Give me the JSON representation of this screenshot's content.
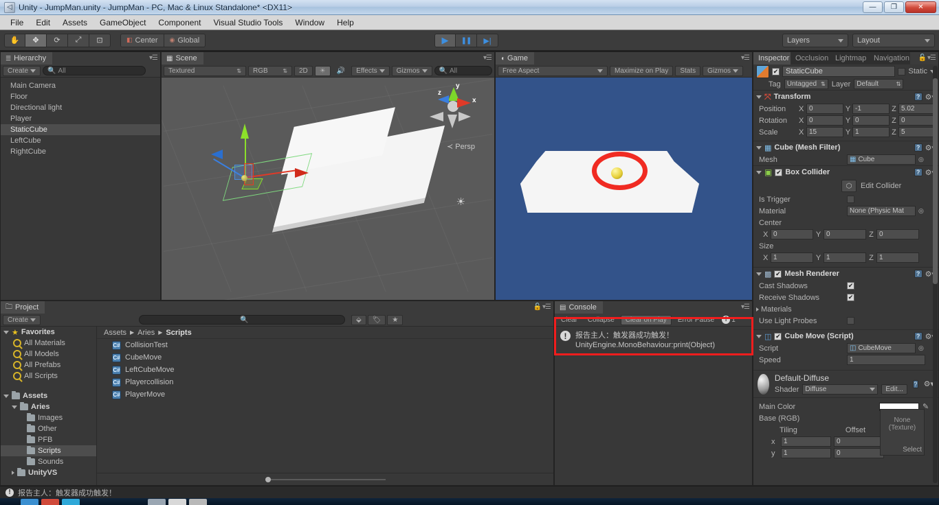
{
  "window": {
    "title": "Unity - JumpMan.unity - JumpMan - PC, Mac & Linux Standalone* <DX11>",
    "minimize": "—",
    "maximize": "❐",
    "close": "✕"
  },
  "menubar": {
    "items": [
      "File",
      "Edit",
      "Assets",
      "GameObject",
      "Component",
      "Visual Studio Tools",
      "Window",
      "Help"
    ]
  },
  "toolbar": {
    "tools": [
      {
        "name": "hand-tool",
        "glyph": "✋",
        "active": false
      },
      {
        "name": "move-tool",
        "glyph": "✥",
        "active": true
      },
      {
        "name": "rotate-tool",
        "glyph": "⟳",
        "active": false
      },
      {
        "name": "scale-tool",
        "glyph": "⤢",
        "active": false
      },
      {
        "name": "rect-tool",
        "glyph": "⊡",
        "active": false
      }
    ],
    "pivot_label": "Center",
    "space_label": "Global",
    "play": "▶",
    "pause": "❚❚",
    "step": "▶|",
    "layers_label": "Layers",
    "layout_label": "Layout"
  },
  "hierarchy": {
    "tab": "Hierarchy",
    "create_label": "Create",
    "search_placeholder": "All",
    "items": [
      {
        "label": "Main Camera",
        "selected": false
      },
      {
        "label": "Floor",
        "selected": false
      },
      {
        "label": "Directional light",
        "selected": false
      },
      {
        "label": "Player",
        "selected": false
      },
      {
        "label": "StaticCube",
        "selected": true
      },
      {
        "label": "LeftCube",
        "selected": false
      },
      {
        "label": "RightCube",
        "selected": false
      }
    ]
  },
  "scene": {
    "tab": "Scene",
    "draw_mode": "Textured",
    "color_mode": "RGB",
    "mode_2d": "2D",
    "effects": "Effects",
    "gizmos": "Gizmos",
    "search_placeholder": "All",
    "persp_label": "Persp",
    "gizmo_axes": {
      "x": "x",
      "y": "y",
      "z": "z"
    }
  },
  "game": {
    "tab": "Game",
    "aspect": "Free Aspect",
    "maximize_on_play": "Maximize on Play",
    "stats": "Stats",
    "gizmos": "Gizmos",
    "background_color": "#33538a",
    "annotation_color": "#f02b22"
  },
  "inspector": {
    "tabs": [
      "Inspector",
      "Occlusion",
      "Lightmap",
      "Navigation"
    ],
    "object_name": "StaticCube",
    "static_label": "Static",
    "static_checked": false,
    "enabled_checked": true,
    "tag_label": "Tag",
    "tag_value": "Untagged",
    "layer_label": "Layer",
    "layer_value": "Default",
    "transform": {
      "title": "Transform",
      "rows": [
        {
          "label": "Position",
          "x": "0",
          "y": "-1",
          "z": "5.02"
        },
        {
          "label": "Rotation",
          "x": "0",
          "y": "0",
          "z": "0"
        },
        {
          "label": "Scale",
          "x": "15",
          "y": "1",
          "z": "5"
        }
      ]
    },
    "mesh_filter": {
      "title": "Cube (Mesh Filter)",
      "mesh_label": "Mesh",
      "mesh_value": "Cube"
    },
    "box_collider": {
      "title": "Box Collider",
      "enabled": true,
      "edit_collider": "Edit Collider",
      "is_trigger_label": "Is Trigger",
      "is_trigger_checked": false,
      "material_label": "Material",
      "material_value": "None (Physic Mat",
      "center_label": "Center",
      "center": {
        "x": "0",
        "y": "0",
        "z": "0"
      },
      "size_label": "Size",
      "size": {
        "x": "1",
        "y": "1",
        "z": "1"
      }
    },
    "mesh_renderer": {
      "title": "Mesh Renderer",
      "enabled": true,
      "cast_shadows_label": "Cast Shadows",
      "cast_shadows_checked": true,
      "receive_shadows_label": "Receive Shadows",
      "receive_shadows_checked": true,
      "materials_label": "Materials",
      "use_light_probes_label": "Use Light Probes",
      "use_light_probes_checked": false
    },
    "cube_move": {
      "title": "Cube Move (Script)",
      "enabled": true,
      "script_label": "Script",
      "script_value": "CubeMove",
      "speed_label": "Speed",
      "speed_value": "1"
    },
    "material": {
      "name": "Default-Diffuse",
      "shader_label": "Shader",
      "shader_value": "Diffuse",
      "edit_label": "Edit...",
      "main_color_label": "Main Color",
      "base_rgb_label": "Base (RGB)",
      "tiling_label": "Tiling",
      "offset_label": "Offset",
      "x_label": "x",
      "y_label": "y",
      "tiling_x": "1",
      "tiling_y": "1",
      "offset_x": "0",
      "offset_y": "0",
      "texture_none": "None",
      "texture_sub": "(Texture)",
      "select_label": "Select"
    }
  },
  "project": {
    "tab": "Project",
    "create_label": "Create",
    "favorites_label": "Favorites",
    "favorites": [
      "All Materials",
      "All Models",
      "All Prefabs",
      "All Scripts"
    ],
    "assets_label": "Assets",
    "tree": [
      {
        "label": "Aries",
        "depth": 1,
        "expanded": true,
        "selected": false
      },
      {
        "label": "Images",
        "depth": 2,
        "expanded": false,
        "selected": false
      },
      {
        "label": "Other",
        "depth": 2,
        "expanded": false,
        "selected": false
      },
      {
        "label": "PFB",
        "depth": 2,
        "expanded": false,
        "selected": false
      },
      {
        "label": "Scripts",
        "depth": 2,
        "expanded": false,
        "selected": true
      },
      {
        "label": "Sounds",
        "depth": 2,
        "expanded": false,
        "selected": false
      },
      {
        "label": "UnityVS",
        "depth": 1,
        "expanded": false,
        "selected": false
      }
    ],
    "breadcrumb": [
      "Assets",
      "Aries",
      "Scripts"
    ],
    "files": [
      "CollisionTest",
      "CubeMove",
      "LeftCubeMove",
      "Playercollision",
      "PlayerMove"
    ]
  },
  "console": {
    "tab": "Console",
    "clear_label": "Clear",
    "collapse_label": "Collapse",
    "clear_on_play_label": "Clear on Play",
    "error_pause_label": "Error Pause",
    "error_count": "1",
    "messages": [
      {
        "line1": "报告主人：触发器成功触发！",
        "line2": "UnityEngine.MonoBehaviour:print(Object)"
      }
    ]
  },
  "status_bar": {
    "message": "报告主人：触发器成功触发！"
  }
}
